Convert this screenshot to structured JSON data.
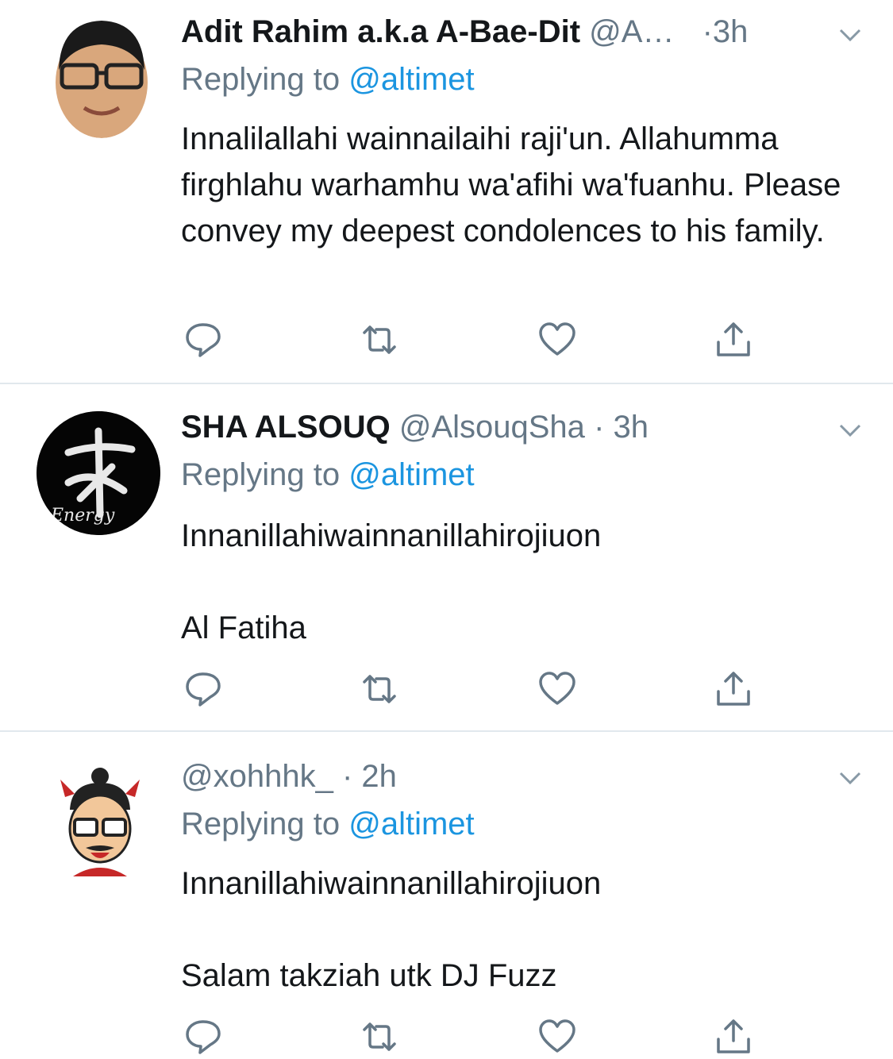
{
  "tweets": [
    {
      "name": "Adit Rahim a.k.a A-Bae-Dit",
      "handle": "@A…",
      "dot": "·",
      "time": "3h",
      "reply_prefix": "Replying to",
      "reply_to": "@altimet",
      "lines": [
        "Innalilallahi wainnailaihi raji'un. Allahumma firghlahu warhamhu wa'afihi wa'fuanhu. Please convey my deepest condolences to his family."
      ]
    },
    {
      "name": "SHA ALSOUQ",
      "handle": "@AlsouqSha",
      "dot": "·",
      "time": "3h",
      "reply_prefix": "Replying to",
      "reply_to": "@altimet",
      "lines": [
        "Innanillahiwainnanillahirojiuon",
        "Al Fatiha"
      ],
      "avatar_text": "Energy"
    },
    {
      "name": "",
      "handle": "@xohhhk_",
      "dot": "·",
      "time": "2h",
      "reply_prefix": "Replying to",
      "reply_to": "@altimet",
      "lines": [
        "Innanillahiwainnanillahirojiuon",
        "Salam takziah utk DJ Fuzz"
      ]
    }
  ],
  "icons": [
    "reply-icon",
    "retweet-icon",
    "like-icon",
    "share-icon",
    "chevron-down-icon"
  ],
  "colors": {
    "link": "#1b95e0",
    "muted": "#657786",
    "text": "#14171a",
    "divider": "#e1e8ed"
  }
}
